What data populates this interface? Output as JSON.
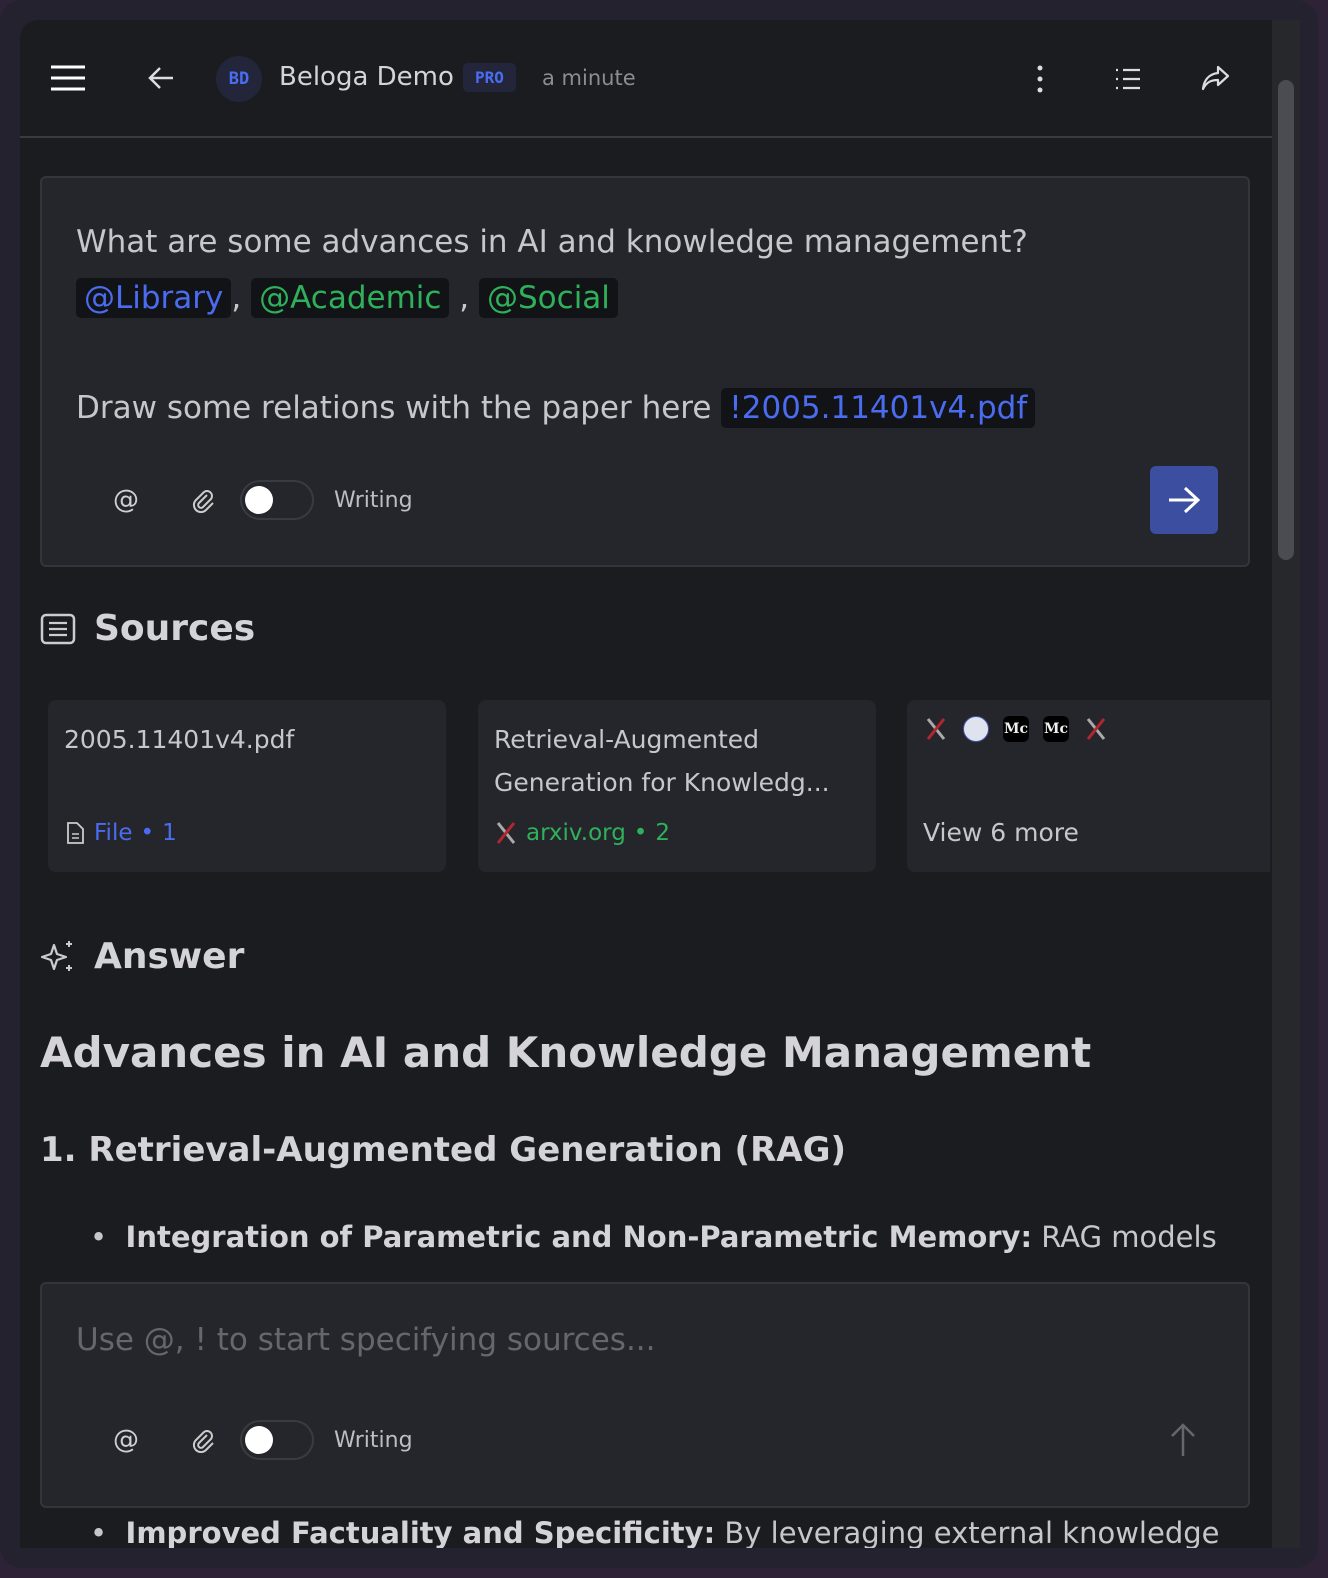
{
  "header": {
    "avatar": "BD",
    "title": "Beloga Demo",
    "badge": "PRO",
    "time": "a minute"
  },
  "query": {
    "line1": "What are some advances in AI and knowledge management?",
    "mentions": [
      "@Library",
      "@Academic",
      "@Social"
    ],
    "line2": "Draw some relations with the paper here",
    "file_ref": "!2005.11401v4.pdf",
    "toggle_label": "Writing",
    "toggle_on": false
  },
  "sources": {
    "title": "Sources",
    "cards": [
      {
        "title": "2005.11401v4.pdf",
        "meta_label": "File",
        "meta_count": "1",
        "icon": "file-icon"
      },
      {
        "title": "Retrieval-Augmented Generation for Knowledg...",
        "meta_label": "arxiv.org",
        "meta_count": "2",
        "icon": "arxiv-icon"
      },
      {
        "favicons": [
          "arxiv-icon",
          "globe-icon",
          "medium-icon",
          "medium-icon",
          "arxiv-icon"
        ],
        "more_label": "View 6 more"
      }
    ]
  },
  "answer": {
    "title": "Answer",
    "heading": "Advances in AI and Knowledge Management",
    "subheading": "1. Retrieval-Augmented Generation (RAG)",
    "bullets": [
      {
        "bold": "Integration of Parametric and Non-Parametric Memory:",
        "text": " RAG models"
      },
      {
        "bold": "Improved Factuality and Specificity:",
        "text": " By leveraging external knowledge"
      }
    ]
  },
  "input": {
    "placeholder": "Use @, ! to start specifying sources...",
    "toggle_label": "Writing",
    "toggle_on": false
  },
  "colors": {
    "accent": "#4a6cf0",
    "green": "#2fb05a",
    "send": "#3b4ea0",
    "bg": "#1b1c20"
  }
}
